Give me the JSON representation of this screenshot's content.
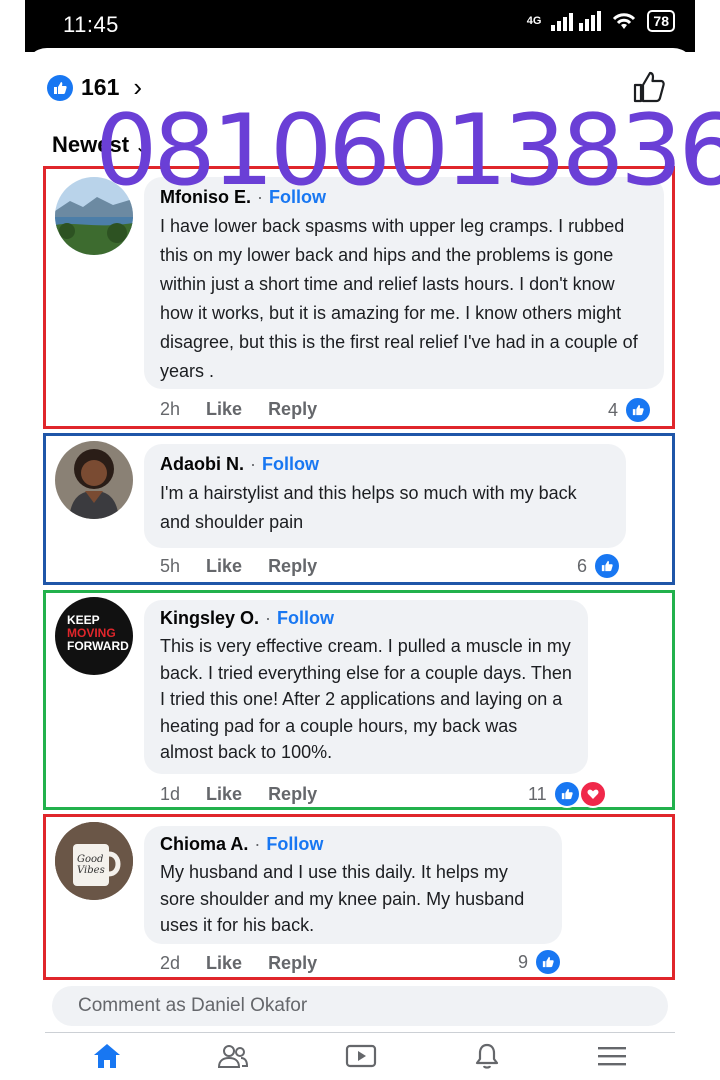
{
  "status": {
    "time": "11:45",
    "network": "4G",
    "battery": "78"
  },
  "header": {
    "reaction_count": "161",
    "sort_label": "Newest"
  },
  "watermark": "08106013836",
  "comments": [
    {
      "name": "Mfoniso E.",
      "follow": "Follow",
      "text": "I have lower back spasms with upper leg cramps. I rubbed this on my lower back and hips and the problems is gone within just a short time and relief lasts hours. I don't know how it works, but it is amazing for me. I know others might disagree, but this is the first real relief I've had in a couple of years .",
      "time": "2h",
      "like": "Like",
      "reply": "Reply",
      "reactions": "4",
      "box_color": "#e0262b"
    },
    {
      "name": "Adaobi N.",
      "follow": "Follow",
      "text": "I'm a hairstylist and this helps so much with my back and shoulder pain",
      "time": "5h",
      "like": "Like",
      "reply": "Reply",
      "reactions": "6",
      "box_color": "#1f56a8"
    },
    {
      "name": "Kingsley O.",
      "follow": "Follow",
      "text": "This is very effective cream. I pulled a muscle in my back. I tried everything else for a couple days. Then I tried this one! After 2 applications and laying on a heating pad for a couple hours, my back was almost back to 100%.",
      "time": "1d",
      "like": "Like",
      "reply": "Reply",
      "reactions": "11",
      "box_color": "#22b14c"
    },
    {
      "name": "Chioma A.",
      "follow": "Follow",
      "text": "My husband and I use this daily. It helps my sore shoulder and my knee pain. My husband uses it for his back.",
      "time": "2d",
      "like": "Like",
      "reply": "Reply",
      "reactions": "9",
      "box_color": "#e0262b"
    }
  ],
  "avatar_text": {
    "keep": "KEEP",
    "moving": "MOVING",
    "forward": "FORWARD",
    "mug1": "Good",
    "mug2": "Vibes"
  },
  "composer": {
    "placeholder": "Comment as Daniel Okafor"
  },
  "nav": [
    "home-icon",
    "friends-icon",
    "video-icon",
    "notifications-icon",
    "menu-icon"
  ],
  "colors": {
    "accent": "#1877f2",
    "watermark": "#6a3fd6"
  }
}
